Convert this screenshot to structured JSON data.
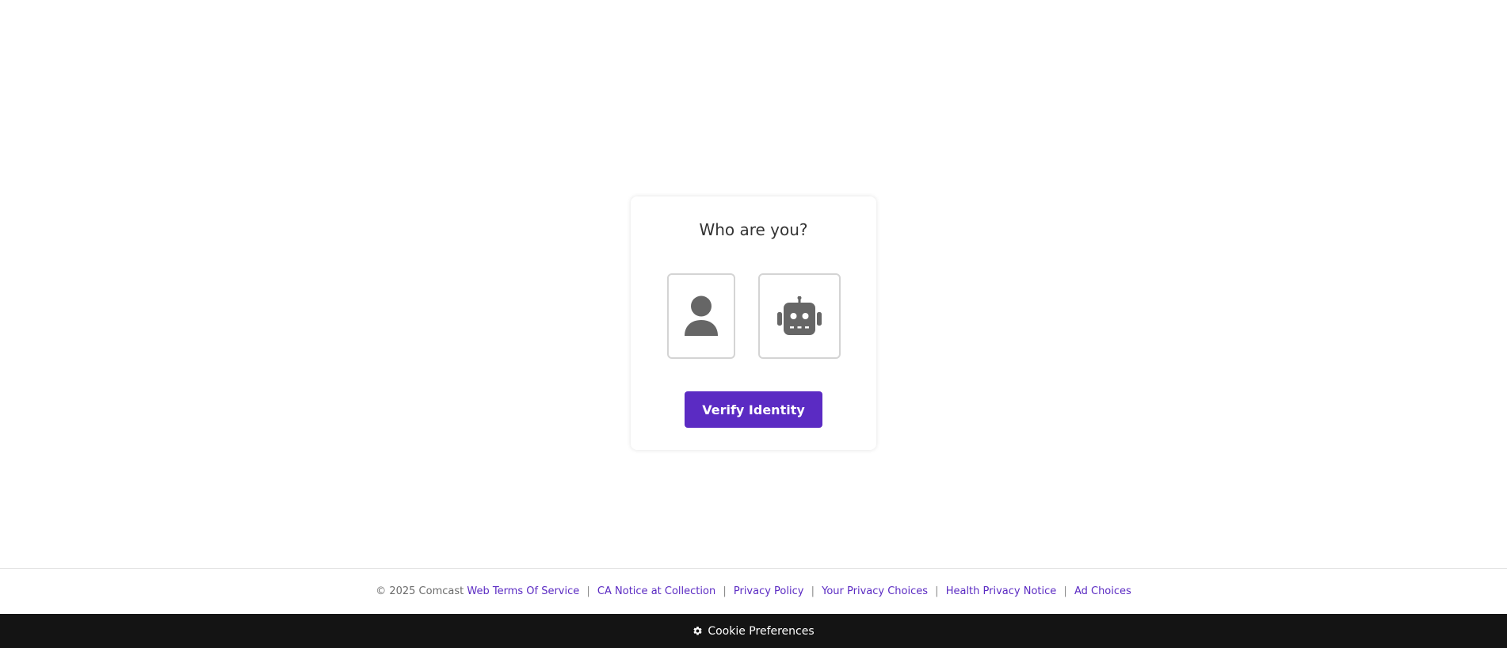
{
  "card": {
    "title": "Who are you?",
    "choices": [
      {
        "icon": "person-icon"
      },
      {
        "icon": "robot-icon"
      }
    ],
    "verify_label": "Verify Identity"
  },
  "footer": {
    "copyright": "© 2025 Comcast",
    "links": [
      "Web Terms Of Service",
      "CA Notice at Collection",
      "Privacy Policy",
      "Your Privacy Choices",
      "Health Privacy Notice",
      "Ad Choices"
    ],
    "separator": "|"
  },
  "cookie_bar": {
    "label": "Cookie Preferences",
    "icon": "gear-icon"
  },
  "colors": {
    "accent": "#5b2bc3",
    "icon_gray": "#666666",
    "cookie_bar_bg": "#141414"
  }
}
